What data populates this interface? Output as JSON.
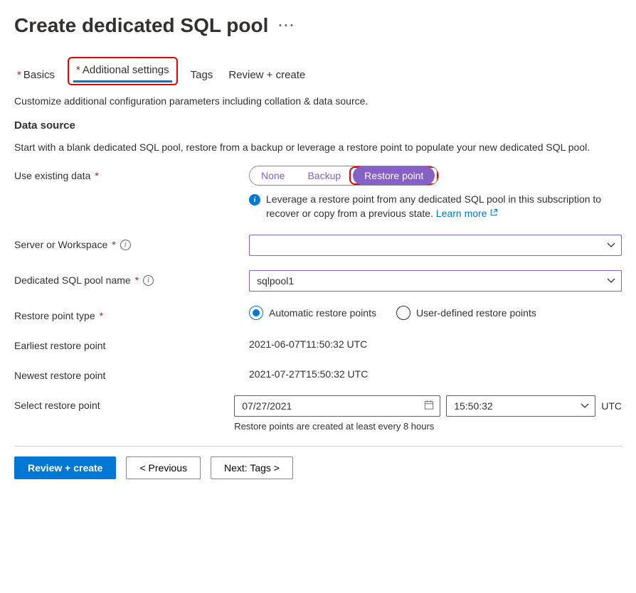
{
  "title": "Create dedicated SQL pool",
  "tabs": {
    "basics": "Basics",
    "additional": "Additional settings",
    "tags": "Tags",
    "review": "Review + create"
  },
  "intro": "Customize additional configuration parameters including collation & data source.",
  "section_data_source": "Data source",
  "data_source_desc": "Start with a blank dedicated SQL pool, restore from a backup or leverage a restore point to populate your new dedicated SQL pool.",
  "fields": {
    "use_existing": "Use existing data",
    "server_or_workspace": "Server or Workspace",
    "pool_name": "Dedicated SQL pool name",
    "restore_point_type": "Restore point type",
    "earliest": "Earliest restore point",
    "newest": "Newest restore point",
    "select_rp": "Select restore point"
  },
  "pills": {
    "none": "None",
    "backup": "Backup",
    "restore": "Restore point"
  },
  "info_text": "Leverage a restore point from any dedicated SQL pool in this subscription to recover or copy from a previous state.",
  "learn_more": "Learn more",
  "values": {
    "server_or_workspace": "",
    "pool_name": "sqlpool1",
    "earliest": "2021-06-07T11:50:32 UTC",
    "newest": "2021-07-27T15:50:32 UTC",
    "date": "07/27/2021",
    "time": "15:50:32",
    "tz": "UTC"
  },
  "radios": {
    "auto": "Automatic restore points",
    "user": "User-defined restore points"
  },
  "helper": "Restore points are created at least every 8 hours",
  "buttons": {
    "review": "Review + create",
    "prev": "< Previous",
    "next": "Next: Tags >"
  }
}
